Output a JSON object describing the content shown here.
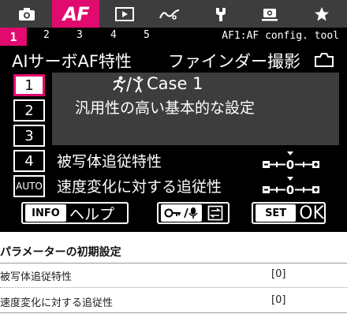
{
  "tabs": [
    {
      "icon": "camera-icon"
    },
    {
      "label": "AF",
      "active": true
    },
    {
      "icon": "play-icon"
    },
    {
      "icon": "wave-icon"
    },
    {
      "icon": "wrench-icon"
    },
    {
      "icon": "mycamera-icon"
    },
    {
      "icon": "star-icon"
    }
  ],
  "pages": {
    "active": "1",
    "others": [
      "2",
      "3",
      "4",
      "5"
    ],
    "section_title": "AF1:AF config. tool"
  },
  "header": {
    "mode_title": "AIサーボAF特性",
    "shoot_label": "ファインダー撮影",
    "shoot_icon": "camera-outline-icon"
  },
  "cases": {
    "items": [
      "1",
      "2",
      "3",
      "4",
      "AUTO"
    ],
    "selected": "1"
  },
  "panel": {
    "case_name": "Case 1",
    "case_desc": "汎用性の高い基本的な設定",
    "icon": "multi-sport-icon"
  },
  "params": [
    {
      "label": "被写体追従特性",
      "scale_value": "0"
    },
    {
      "label": "速度変化に対する追従性",
      "scale_value": "0"
    }
  ],
  "buttons": {
    "info_chip": "INFO",
    "info_text": "ヘルプ",
    "key_icon": "key-mic-icon",
    "switch_icon": "switch-icon",
    "set_chip": "SET",
    "set_text": "OK"
  },
  "table": {
    "title": "パラメーターの初期設定",
    "rows": [
      {
        "name": "被写体追従特性",
        "value": "[0]"
      },
      {
        "name": "速度変化に対する追従性",
        "value": "[0]"
      }
    ]
  },
  "colors": {
    "accent": "#e10a6e",
    "tabbar": "#3d3d3d",
    "panel": "#3d3d3d"
  }
}
